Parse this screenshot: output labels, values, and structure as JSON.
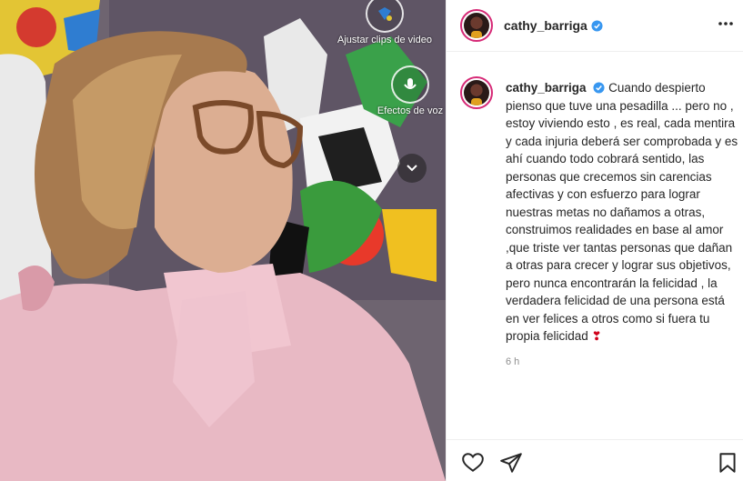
{
  "post": {
    "username": "cathy_barriga",
    "caption_username": "cathy_barriga",
    "caption": "Cuando despierto pienso que tuve una pesadilla ... pero no , estoy viviendo esto , es real, cada mentira y cada injuria deberá ser comprobada y es ahí cuando todo cobrará sentido, las personas que crecemos sin carencias afectivas y con esfuerzo para lograr nuestras metas no dañamos a otras, construimos realidades en base al amor ,que triste ver tantas personas que dañan a otras para crecer y lograr sus objetivos, pero nunca encontrarán la felicidad , la verdadera felicidad de una persona está en ver felices a otros como si fuera tu propia felicidad",
    "caption_emoji": "❣",
    "timestamp": "6 h"
  },
  "media_overlay": {
    "adjust_label": "Ajustar clips de video",
    "effects_label": "Efectos de voz"
  },
  "icons": {
    "verified": "verified-badge-icon",
    "more": "more-options-icon",
    "like": "heart-outline-icon",
    "share": "paper-plane-icon",
    "save": "bookmark-outline-icon",
    "chevron": "chevron-down-icon"
  },
  "colors": {
    "verified_blue": "#3897f0",
    "story_ring": "#d62976",
    "muted_text": "#8e8e8e"
  }
}
